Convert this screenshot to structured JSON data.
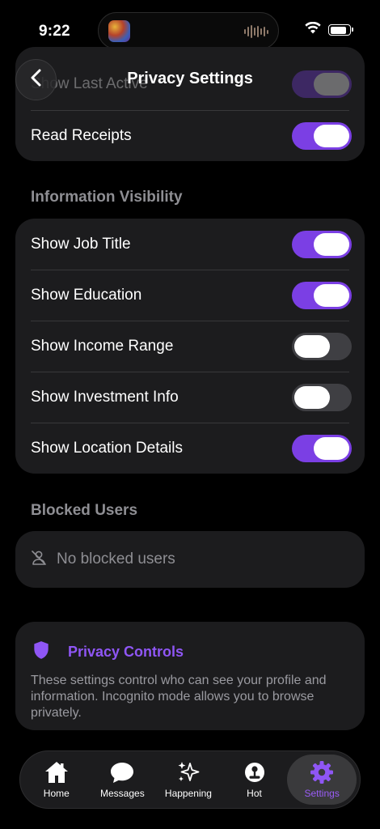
{
  "status_bar": {
    "time": "9:22"
  },
  "header": {
    "title": "Privacy Settings"
  },
  "top_card": {
    "rows": [
      {
        "label": "Show Last Active",
        "on": true
      },
      {
        "label": "Read Receipts",
        "on": true
      }
    ]
  },
  "visibility": {
    "title": "Information Visibility",
    "rows": [
      {
        "label": "Show Job Title",
        "on": true
      },
      {
        "label": "Show Education",
        "on": true
      },
      {
        "label": "Show Income Range",
        "on": false
      },
      {
        "label": "Show Investment Info",
        "on": false
      },
      {
        "label": "Show Location Details",
        "on": true
      }
    ]
  },
  "blocked": {
    "title": "Blocked Users",
    "empty_text": "No blocked users"
  },
  "privacy_info": {
    "title": "Privacy Controls",
    "description": "These settings control who can see your profile and information. Incognito mode allows you to browse privately."
  },
  "tabbar": {
    "tabs": [
      {
        "label": "Home",
        "icon": "house-icon",
        "active": false
      },
      {
        "label": "Messages",
        "icon": "chat-bubble-icon",
        "active": false
      },
      {
        "label": "Happening",
        "icon": "sparkles-icon",
        "active": false
      },
      {
        "label": "Hot",
        "icon": "joystick-icon",
        "active": false
      },
      {
        "label": "Settings",
        "icon": "gear-icon",
        "active": true
      }
    ]
  },
  "colors": {
    "accent": "#7b3fe4",
    "accent_text": "#8f56f5",
    "card": "#1c1c1e",
    "background": "#000000"
  }
}
